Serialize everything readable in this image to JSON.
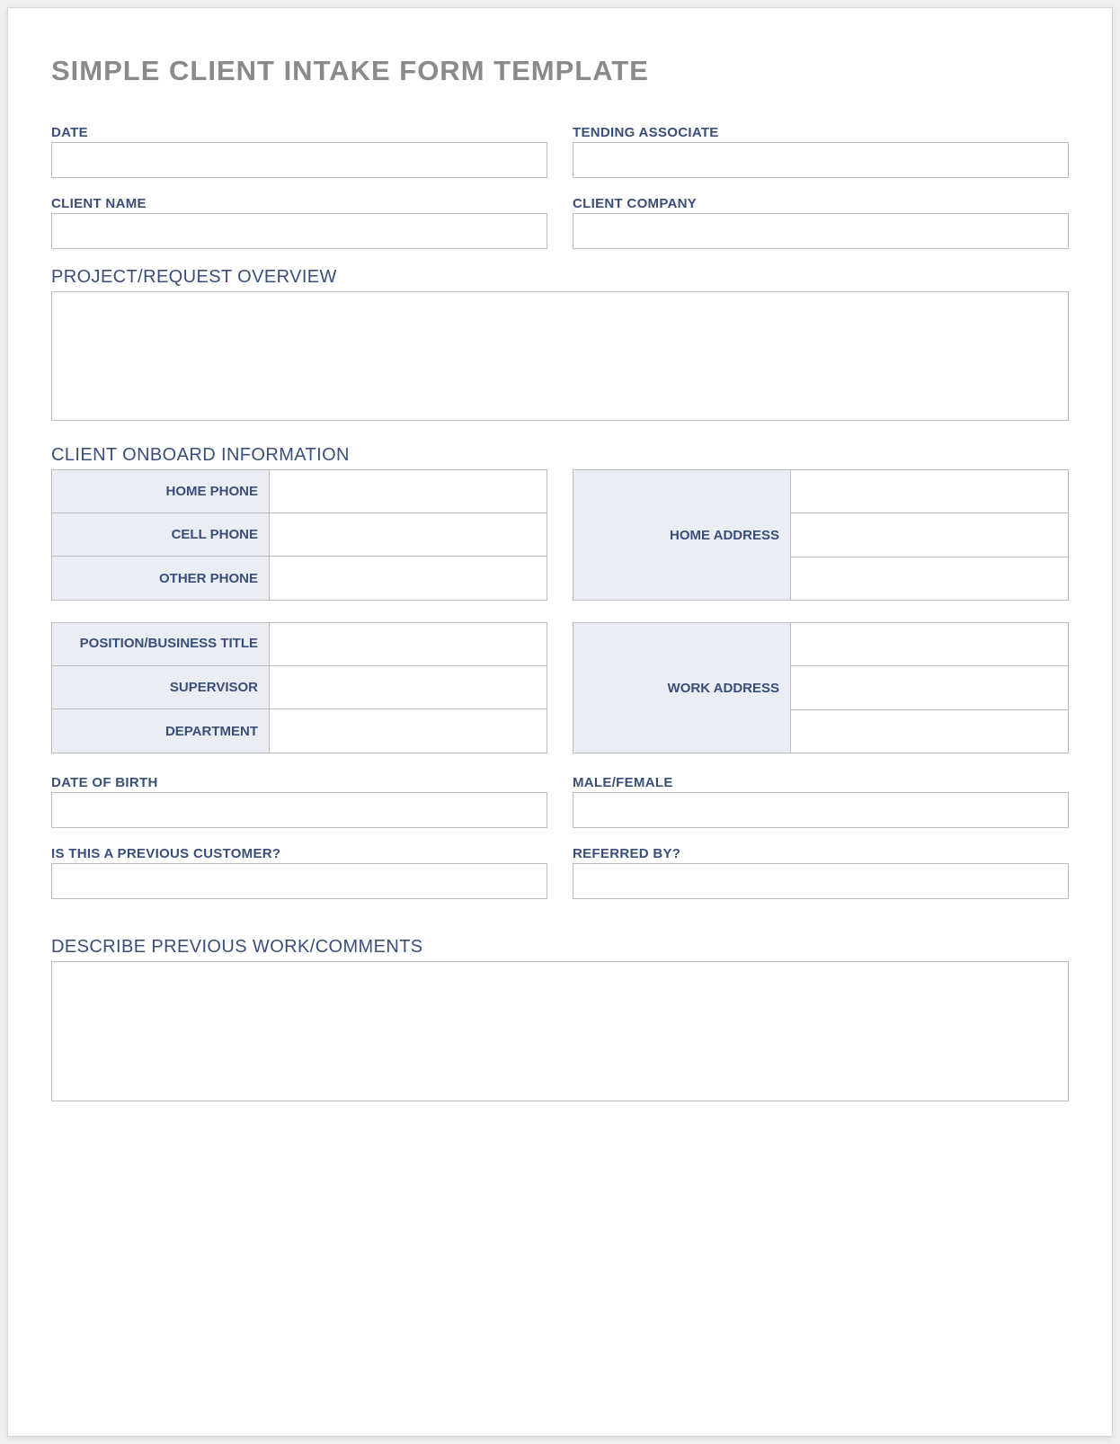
{
  "title": "SIMPLE CLIENT INTAKE FORM TEMPLATE",
  "top": {
    "date_label": "DATE",
    "date_value": "",
    "associate_label": "TENDING ASSOCIATE",
    "associate_value": "",
    "client_name_label": "CLIENT NAME",
    "client_name_value": "",
    "client_company_label": "CLIENT COMPANY",
    "client_company_value": ""
  },
  "sections": {
    "project_overview_heading": "PROJECT/REQUEST OVERVIEW",
    "project_overview_value": "",
    "client_onboard_heading": "CLIENT ONBOARD INFORMATION",
    "describe_previous_heading": "DESCRIBE PREVIOUS WORK/COMMENTS",
    "describe_previous_value": ""
  },
  "phones": {
    "home_phone_label": "HOME PHONE",
    "home_phone_value": "",
    "cell_phone_label": "CELL PHONE",
    "cell_phone_value": "",
    "other_phone_label": "OTHER PHONE",
    "other_phone_value": "",
    "home_address_label": "HOME ADDRESS",
    "home_address_line1": "",
    "home_address_line2": "",
    "home_address_line3": ""
  },
  "work": {
    "position_label": "POSITION/BUSINESS TITLE",
    "position_value": "",
    "supervisor_label": "SUPERVISOR",
    "supervisor_value": "",
    "department_label": "DEPARTMENT",
    "department_value": "",
    "work_address_label": "WORK ADDRESS",
    "work_address_line1": "",
    "work_address_line2": "",
    "work_address_line3": ""
  },
  "personal": {
    "dob_label": "DATE OF BIRTH",
    "dob_value": "",
    "gender_label": "MALE/FEMALE",
    "gender_value": "",
    "previous_customer_label": "IS THIS A PREVIOUS CUSTOMER?",
    "previous_customer_value": "",
    "referred_by_label": "REFERRED BY?",
    "referred_by_value": ""
  }
}
